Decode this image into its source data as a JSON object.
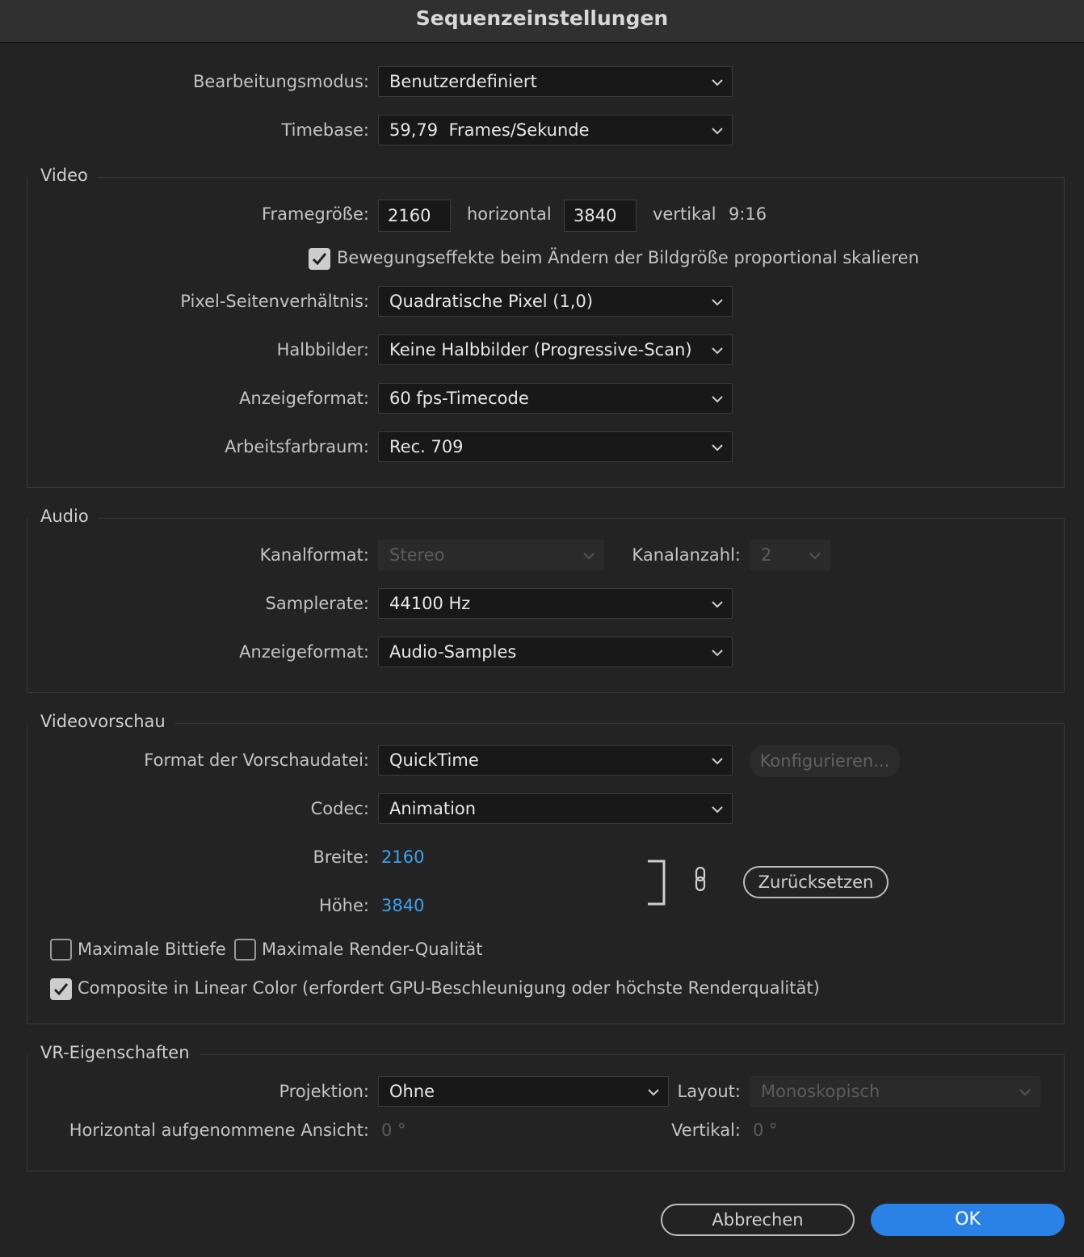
{
  "window": {
    "title": "Sequenzeinstellungen"
  },
  "general": {
    "editing_mode_label": "Bearbeitungsmodus:",
    "editing_mode_value": "Benutzerdefiniert",
    "timebase_label": "Timebase:",
    "timebase_value": "59,79  Frames/Sekunde"
  },
  "video": {
    "group_title": "Video",
    "frame_size_label": "Framegröße:",
    "frame_width": "2160",
    "horizontal_label": "horizontal",
    "frame_height": "3840",
    "vertical_label": "vertikal",
    "aspect_ratio": "9:16",
    "scale_checkbox_label": "Bewegungseffekte beim Ändern der Bildgröße proportional skalieren",
    "scale_checkbox_checked": true,
    "pixel_aspect_label": "Pixel-Seitenverhältnis:",
    "pixel_aspect_value": "Quadratische Pixel (1,0)",
    "fields_label": "Halbbilder:",
    "fields_value": "Keine Halbbilder (Progressive-Scan)",
    "display_format_label": "Anzeigeformat:",
    "display_format_value": "60 fps-Timecode",
    "color_space_label": "Arbeitsfarbraum:",
    "color_space_value": "Rec. 709"
  },
  "audio": {
    "group_title": "Audio",
    "channel_format_label": "Kanalformat:",
    "channel_format_value": "Stereo",
    "channel_count_label": "Kanalanzahl:",
    "channel_count_value": "2",
    "sample_rate_label": "Samplerate:",
    "sample_rate_value": "44100 Hz",
    "display_format_label": "Anzeigeformat:",
    "display_format_value": "Audio-Samples"
  },
  "preview": {
    "group_title": "Videovorschau",
    "file_format_label": "Format der Vorschaudatei:",
    "file_format_value": "QuickTime",
    "configure_label": "Konfigurieren...",
    "codec_label": "Codec:",
    "codec_value": "Animation",
    "width_label": "Breite:",
    "width_value": "2160",
    "height_label": "Höhe:",
    "height_value": "3840",
    "reset_label": "Zurücksetzen",
    "max_bit_depth_label": "Maximale Bittiefe",
    "max_bit_depth_checked": false,
    "max_render_quality_label": "Maximale Render-Qualität",
    "max_render_quality_checked": false,
    "linear_color_label": "Composite in Linear Color (erfordert GPU-Beschleunigung oder höchste Renderqualität)",
    "linear_color_checked": true
  },
  "vr": {
    "group_title": "VR-Eigenschaften",
    "projection_label": "Projektion:",
    "projection_value": "Ohne",
    "layout_label": "Layout:",
    "layout_value": "Monoskopisch",
    "horizontal_view_label": "Horizontal aufgenommene Ansicht:",
    "horizontal_view_value": "0 °",
    "vertical_label": "Vertikal:",
    "vertical_value": "0 °"
  },
  "footer": {
    "cancel_label": "Abbrechen",
    "ok_label": "OK"
  },
  "colors": {
    "accent": "#2b82e6",
    "link_value": "#3fa0ee",
    "background": "#232323"
  }
}
